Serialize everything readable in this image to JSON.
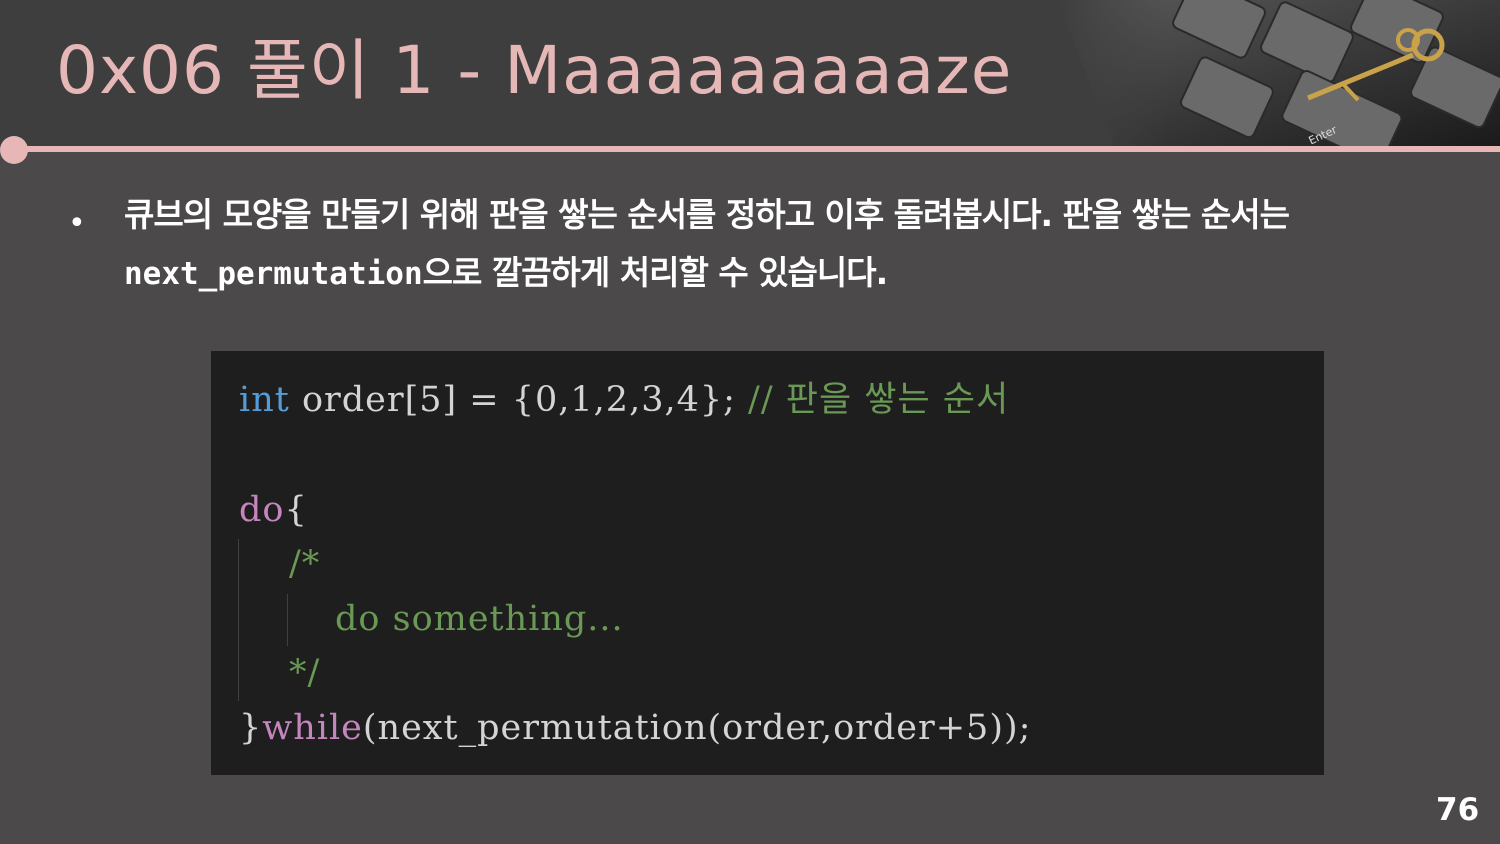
{
  "slide": {
    "title": "0x06  풀이 1 - Maaaaaaaaaze",
    "bullet": {
      "text_before": "큐브의 모양을 만들기 위해 판을 쌓는 순서를 정하고 이후 돌려봅시다. 판을 쌓는 순서는 ",
      "code": "next_permutation",
      "text_after": "으로 깔끔하게 처리할 수 있습니다."
    },
    "code_block": {
      "line1": {
        "kw": "int",
        "rest": " order[5] = {0,1,2,3,4}; ",
        "comment": "// 판을 쌓는 순서"
      },
      "line2": {
        "kw": "do",
        "rest": "{"
      },
      "line3": {
        "comment": "/*"
      },
      "line4": {
        "comment": "do something..."
      },
      "line5": {
        "comment": "*/"
      },
      "line6": {
        "prefix": "}",
        "kw": "while",
        "rest": "(next_permutation(order,order+5));"
      }
    },
    "page_number": "76"
  },
  "icons": [
    "keyboard-key-image",
    "enter-key-label"
  ],
  "colors": {
    "accent": "#e7b7b7",
    "background": "#4b4949",
    "code_bg": "#1e1e1e",
    "keyword_blue": "#569cd6",
    "keyword_purple": "#c586c0",
    "comment_green": "#6a9955"
  }
}
